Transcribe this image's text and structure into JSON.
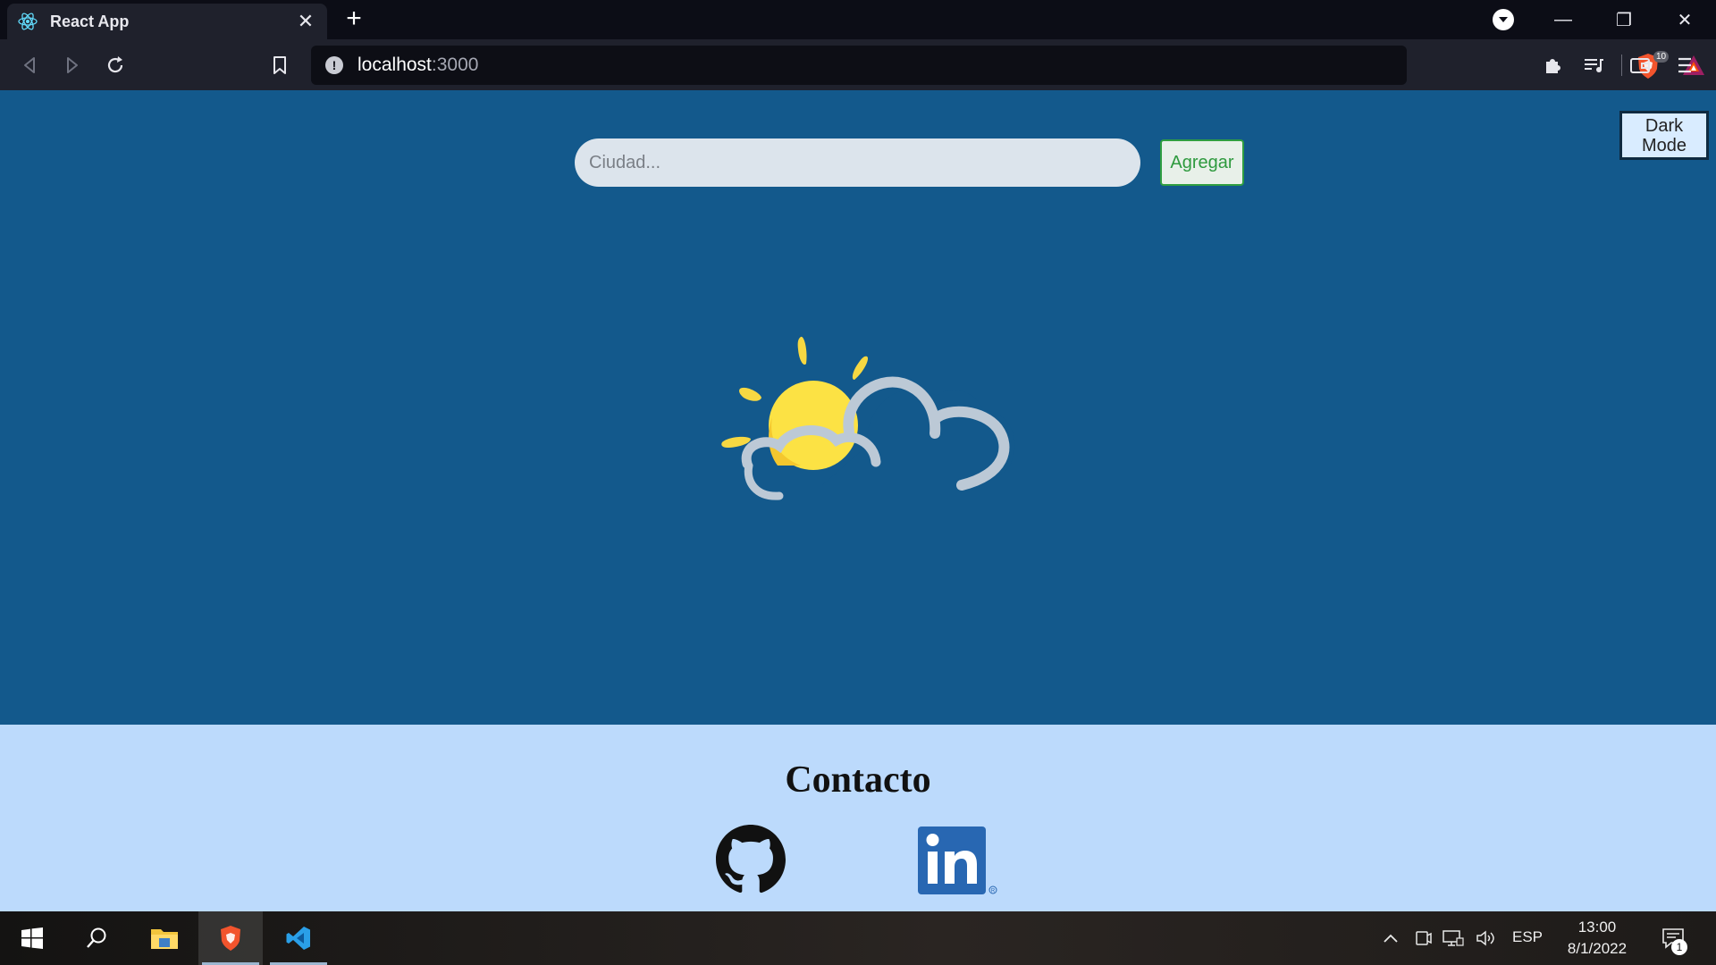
{
  "browser": {
    "tab_title": "React App",
    "tab_close": "✕",
    "new_tab": "+",
    "url_host": "localhost",
    "url_port": ":3000",
    "shield_count": "10",
    "window_controls": {
      "minimize": "—",
      "restore": "❐",
      "close": "✕"
    }
  },
  "page": {
    "search": {
      "placeholder": "Ciudad...",
      "value": ""
    },
    "add_label": "Agregar",
    "dark_mode_label": "Dark Mode",
    "weather_icon": "partly-cloudy-icon"
  },
  "footer": {
    "title": "Contacto",
    "links": [
      "github-icon",
      "linkedin-icon"
    ]
  },
  "taskbar": {
    "apps": [
      "windows-start",
      "search",
      "file-explorer",
      "brave-browser",
      "vscode"
    ],
    "language": "ESP",
    "time": "13:00",
    "date": "8/1/2022",
    "notification_count": "1"
  },
  "colors": {
    "page_bg": "#13598c",
    "footer_bg": "#bcdafc",
    "add_button": "#2e9a3e",
    "chrome_dark": "#1f212c"
  }
}
